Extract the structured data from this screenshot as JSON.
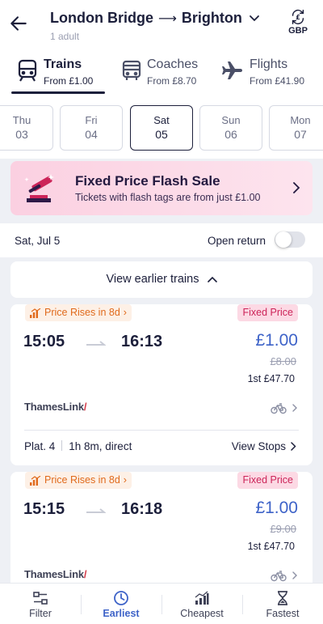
{
  "header": {
    "origin": "London Bridge",
    "destination": "Brighton",
    "passengers": "1 adult",
    "currency": "GBP"
  },
  "modes": [
    {
      "label": "Trains",
      "price": "From £1.00",
      "icon": "train-icon",
      "active": true
    },
    {
      "label": "Coaches",
      "price": "From £8.70",
      "icon": "coach-icon",
      "active": false
    },
    {
      "label": "Flights",
      "price": "From £41.90",
      "icon": "plane-icon",
      "active": false
    }
  ],
  "dates": [
    {
      "day": "Thu",
      "num": "03"
    },
    {
      "day": "Fri",
      "num": "04"
    },
    {
      "day": "Sat",
      "num": "05"
    },
    {
      "day": "Sun",
      "num": "06"
    },
    {
      "day": "Mon",
      "num": "07"
    }
  ],
  "selected_date_index": 2,
  "flash_sale": {
    "title": "Fixed Price Flash Sale",
    "subtitle": "Tickets with flash tags are from just £1.00"
  },
  "journey_date": "Sat, Jul 5",
  "open_return_label": "Open return",
  "open_return_on": false,
  "earlier_trains_label": "View earlier trains",
  "journeys": [
    {
      "rise_label": "Price Rises in 8d",
      "fixed_label": "Fixed Price",
      "depart": "15:05",
      "arrive": "16:13",
      "price": "£1.00",
      "was_price": "£8.00",
      "first_class": "1st £47.70",
      "operator": "ThamesLink",
      "operator_mark": "/",
      "platform": "Plat. 4",
      "duration": "1h 8m, direct",
      "stops_label": "View Stops"
    },
    {
      "rise_label": "Price Rises in 8d",
      "fixed_label": "Fixed Price",
      "depart": "15:15",
      "arrive": "16:18",
      "price": "£1.00",
      "was_price": "£9.00",
      "first_class": "1st £47.70",
      "operator": "ThamesLink",
      "operator_mark": "/"
    }
  ],
  "bottom_tabs": [
    {
      "label": "Filter",
      "icon": "filter-icon"
    },
    {
      "label": "Earliest",
      "icon": "clock-icon",
      "active": true
    },
    {
      "label": "Cheapest",
      "icon": "bar-chart-icon"
    },
    {
      "label": "Fastest",
      "icon": "hourglass-icon"
    }
  ],
  "colors": {
    "navy": "#1c1f3b",
    "accent_blue": "#3e63c8",
    "flash_pink": "#fbd0e1",
    "rise_orange": "#e06a1c",
    "fixed_red": "#cc2459"
  }
}
